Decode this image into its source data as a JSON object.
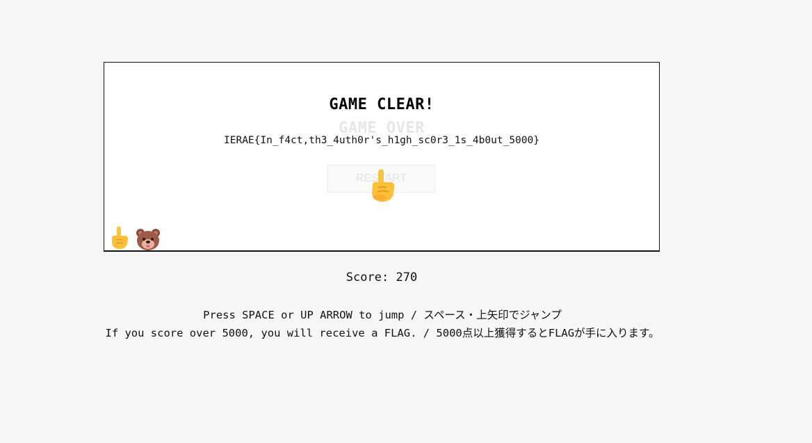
{
  "game": {
    "clear_title": "GAME CLEAR!",
    "over_title": "GAME OVER",
    "flag": "IERAE{In_f4ct,th3_4uth0r's_h1gh_sc0r3_1s_4b0ut_5000}",
    "restart_label": "RESTART"
  },
  "score": {
    "label": "Score:",
    "value": "270"
  },
  "instructions": {
    "line1": "Press SPACE or UP ARROW to jump / スペース・上矢印でジャンプ",
    "line2": "If you score over 5000, you will receive a FLAG. / 5000点以上獲得するとFLAGが手に入ります。"
  },
  "icons": {
    "cursor": "pointing-hand-icon",
    "player": "pointing-hand-icon",
    "enemy": "bear-face-icon"
  },
  "colors": {
    "background": "#f6f6f6",
    "canvas": "#ffffff",
    "text": "#111111",
    "faded": "#e6e6e6"
  }
}
